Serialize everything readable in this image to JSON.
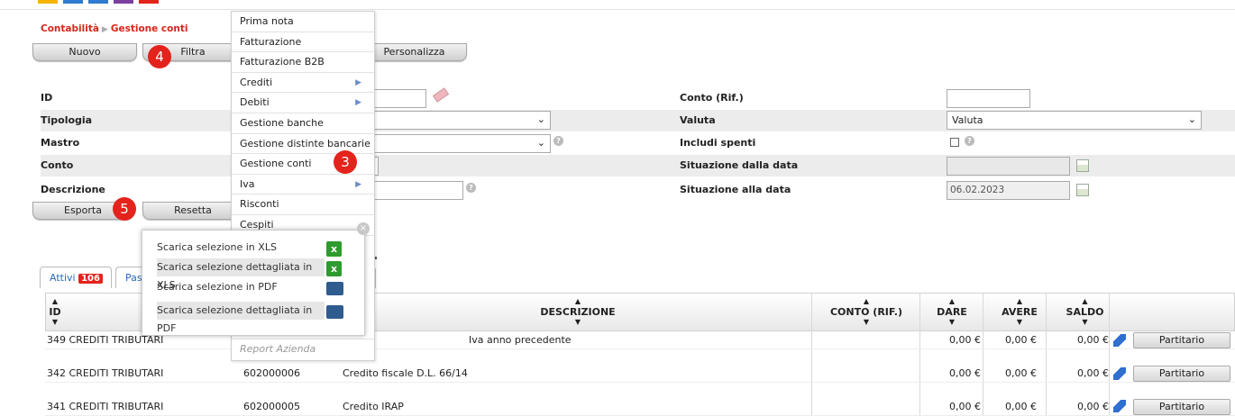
{
  "breadcrumb": {
    "root": "Contabilità",
    "current": "Gestione conti"
  },
  "toolbar": {
    "nuovo": "Nuovo",
    "filtra": "Filtra",
    "personalizza": "Personalizza",
    "esporta": "Esporta",
    "resetta": "Resetta"
  },
  "callouts": {
    "c3": "3",
    "c4": "4",
    "c5": "5"
  },
  "form": {
    "id_label": "ID",
    "tipologia_label": "Tipologia",
    "mastro_label": "Mastro",
    "conto_label": "Conto",
    "descrizione_label": "Descrizione",
    "conto_rif_label": "Conto (Rif.)",
    "valuta_label": "Valuta",
    "valuta_value": "Valuta",
    "includi_spenti_label": "Includi spenti",
    "situazione_dalla_label": "Situazione dalla data",
    "situazione_alla_label": "Situazione alla data",
    "situazione_alla_value": "06.02.2023"
  },
  "menu": {
    "items": [
      {
        "label": "Prima nota"
      },
      {
        "label": "Fatturazione"
      },
      {
        "label": "Fatturazione B2B"
      },
      {
        "label": "Crediti",
        "sub": "▶"
      },
      {
        "label": "Debiti",
        "sub": "▶"
      },
      {
        "label": "Gestione banche"
      },
      {
        "label": "Gestione distinte bancarie"
      },
      {
        "label": "Gestione conti"
      },
      {
        "label": "Iva",
        "sub": "▶"
      },
      {
        "label": "Risconti"
      },
      {
        "label": "Cespiti"
      }
    ],
    "report_azienda": "Report Azienda"
  },
  "export_popup": {
    "items": [
      "Scarica selezione in XLS",
      "Scarica selezione dettagliata in XLS",
      "Scarica selezione in PDF",
      "Scarica selezione dettagliata in PDF"
    ],
    "close": "×"
  },
  "tabs": {
    "attivi": "Attivi",
    "attivi_count": "106",
    "passivi": "Pas"
  },
  "table": {
    "headers": {
      "id": "ID",
      "descrizione": "DESCRIZIONE",
      "conto_rif": "CONTO (RIF.)",
      "dare": "DARE",
      "avere": "AVERE",
      "saldo": "SALDO"
    },
    "rows": [
      {
        "id_tipo": "349 CREDITI TRIBUTARI",
        "conto": "",
        "descr": "Iva anno precedente",
        "dare": "0,00 €",
        "avere": "0,00 €",
        "saldo": "0,00 €",
        "action": "Partitario"
      },
      {
        "id_tipo": "342 CREDITI TRIBUTARI",
        "conto": "602000006",
        "descr": "Credito fiscale D.L. 66/14",
        "dare": "0,00 €",
        "avere": "0,00 €",
        "saldo": "0,00 €",
        "action": "Partitario"
      },
      {
        "id_tipo": "341 CREDITI TRIBUTARI",
        "conto": "602000005",
        "descr": "Credito IRAP",
        "dare": "0,00 €",
        "avere": "0,00 €",
        "saldo": "0,00 €",
        "action": "Partitario"
      }
    ]
  },
  "colors": {
    "accent_red": "#e3231c",
    "link_blue": "#2a6cb5"
  }
}
